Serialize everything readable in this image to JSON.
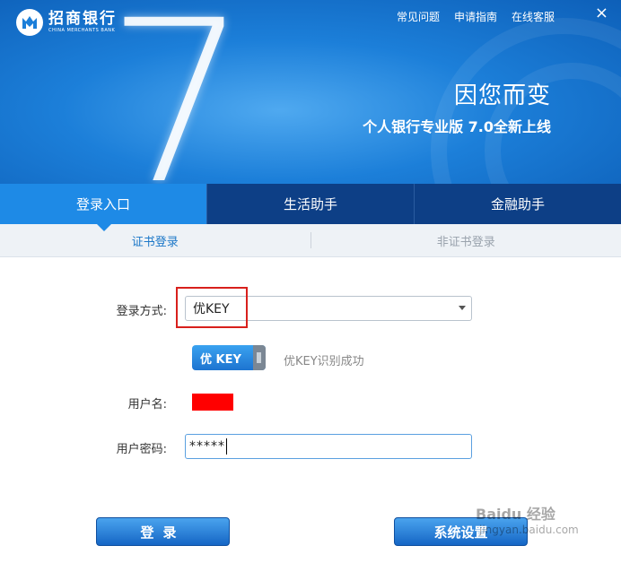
{
  "brand": {
    "name_cn": "招商银行",
    "name_en": "CHINA MERCHANTS BANK"
  },
  "top_links": [
    "常见问题",
    "申请指南",
    "在线客服"
  ],
  "close_label": "×",
  "banner": {
    "version_digit": "7",
    "slogan": "因您而变",
    "subtitle": "个人银行专业版 7.0全新上线"
  },
  "tabs": [
    {
      "label": "登录入口",
      "active": true
    },
    {
      "label": "生活助手",
      "active": false
    },
    {
      "label": "金融助手",
      "active": false
    }
  ],
  "subtabs": [
    {
      "label": "证书登录",
      "active": true
    },
    {
      "label": "非证书登录",
      "active": false
    }
  ],
  "form": {
    "login_method_label": "登录方式:",
    "login_method_value": "优KEY",
    "ukey_label": "优 KEY",
    "ukey_status": "优KEY识别成功",
    "username_label": "用户名:",
    "password_label": "用户密码:",
    "password_value": "*****"
  },
  "buttons": {
    "login": "登录",
    "settings": "系统设置"
  },
  "watermark": {
    "text": "Baidu 经验",
    "sub": "jingyan.baidu.com"
  },
  "colors": {
    "banner_blue": "#1c7fd9",
    "tab_dark": "#0d3f86",
    "tab_active": "#1e8ae6",
    "highlight_red": "#d8201c"
  }
}
